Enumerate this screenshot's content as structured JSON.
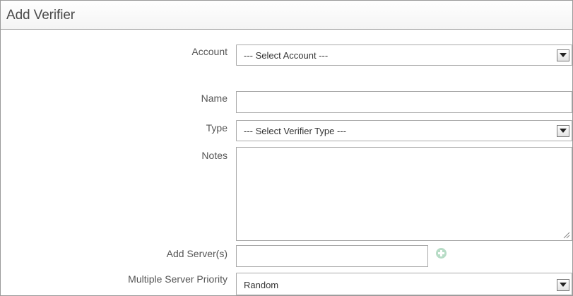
{
  "panel": {
    "title": "Add Verifier"
  },
  "form": {
    "account": {
      "label": "Account",
      "selected": "--- Select Account ---"
    },
    "name": {
      "label": "Name",
      "value": ""
    },
    "type": {
      "label": "Type",
      "selected": "--- Select Verifier Type ---"
    },
    "notes": {
      "label": "Notes",
      "value": ""
    },
    "add_servers": {
      "label": "Add Server(s)",
      "value": ""
    },
    "server_priority": {
      "label": "Multiple Server Priority",
      "selected": "Random"
    }
  },
  "icons": {
    "dropdown": "chevron-down-icon",
    "add": "plus-icon",
    "resize": "resize-grip-icon"
  }
}
